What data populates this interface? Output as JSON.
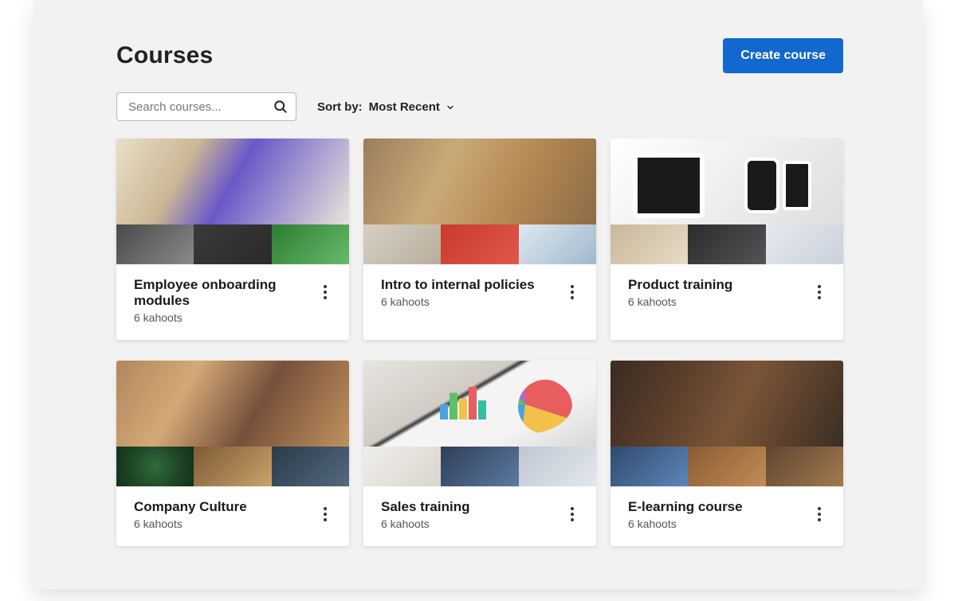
{
  "header": {
    "title": "Courses",
    "create_label": "Create course"
  },
  "search": {
    "placeholder": "Search courses..."
  },
  "sort": {
    "label": "Sort by:",
    "value": "Most Recent"
  },
  "courses": [
    {
      "title": "Employee onboarding modules",
      "sub": "6 kahoots"
    },
    {
      "title": "Intro to internal policies",
      "sub": "6 kahoots"
    },
    {
      "title": "Product training",
      "sub": "6 kahoots"
    },
    {
      "title": "Company Culture",
      "sub": "6 kahoots"
    },
    {
      "title": "Sales training",
      "sub": "6 kahoots"
    },
    {
      "title": "E-learning course",
      "sub": "6 kahoots"
    }
  ]
}
